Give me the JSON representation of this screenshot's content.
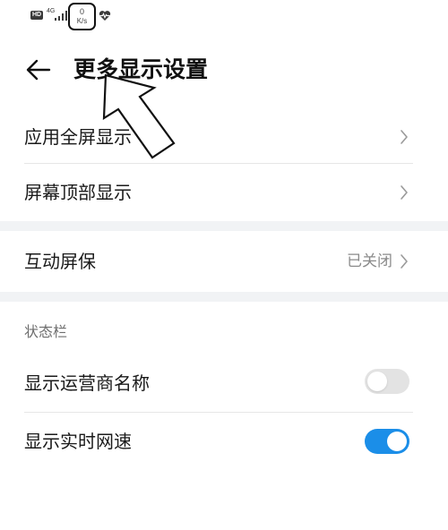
{
  "status_bar": {
    "hd_label": "HD",
    "network_label": "4G",
    "speed_value": "0",
    "speed_unit": "K/s"
  },
  "header": {
    "back_icon": "arrow-left-icon",
    "title": "更多显示设置"
  },
  "rows": {
    "fullscreen_apps": {
      "label": "应用全屏显示"
    },
    "top_display": {
      "label": "屏幕顶部显示"
    },
    "screensaver": {
      "label": "互动屏保",
      "value": "已关闭"
    }
  },
  "status_section": {
    "header": "状态栏",
    "carrier_name": {
      "label": "显示运营商名称",
      "enabled": false
    },
    "realtime_speed": {
      "label": "显示实时网速",
      "enabled": true
    }
  },
  "colors": {
    "toggle_on": "#1b8ee8",
    "toggle_off": "#e3e3e3",
    "section_band": "#f1f3f5"
  }
}
